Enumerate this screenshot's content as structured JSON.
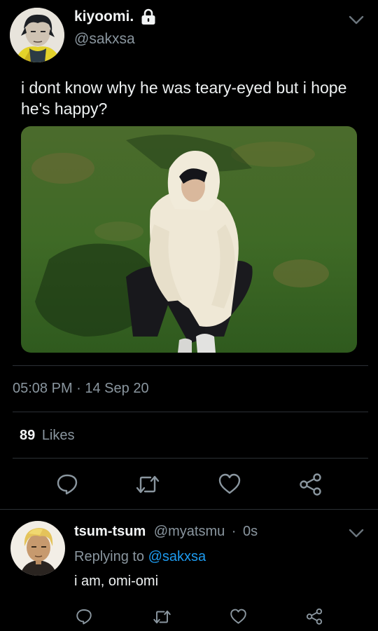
{
  "tweet": {
    "author": {
      "display_name": "kiyoomi.",
      "handle": "@sakxsa",
      "protected_icon": "lock-icon",
      "avatar": "avatar-image"
    },
    "text": "i dont know why he was teary-eyed but i hope he's happy?",
    "media": "photo of a person in a cream hooded fleece sitting on grass",
    "timestamp": "05:08 PM · 14 Sep 20",
    "likes": {
      "count": "89",
      "label": "Likes"
    },
    "actions": [
      "reply-icon",
      "retweet-icon",
      "like-icon",
      "share-icon"
    ],
    "menu_icon": "chevron-down-icon"
  },
  "reply": {
    "author": {
      "display_name": "tsum-tsum",
      "handle": "@myatsmu",
      "separator": "·",
      "time": "0s"
    },
    "replying_to_label": "Replying to",
    "replying_to_handle": "@sakxsa",
    "text": "i am, omi-omi",
    "actions": [
      "reply-icon",
      "retweet-icon",
      "like-icon",
      "share-icon"
    ]
  },
  "colors": {
    "background": "#000000",
    "text_primary": "#eef1f2",
    "text_secondary": "#8a969f",
    "link": "#1d9bf0",
    "divider": "#2b3035"
  }
}
